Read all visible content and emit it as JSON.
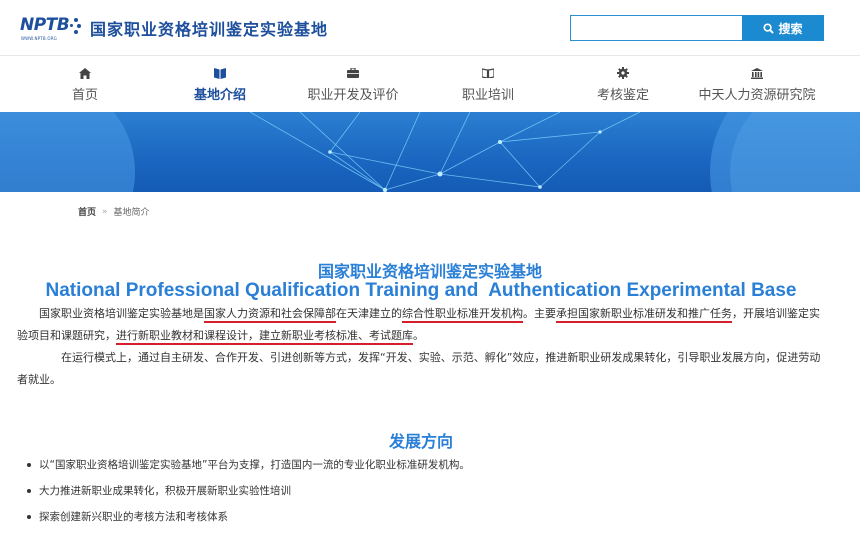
{
  "header": {
    "logo_text": "NPTB",
    "logo_sub": "WWW.NPTB.ORG",
    "site_title": "国家职业资格培训鉴定实验基地",
    "search": {
      "placeholder": "",
      "value": "",
      "button_label": "搜索",
      "button_icon": "search-icon"
    }
  },
  "nav": {
    "items": [
      {
        "label": "首页",
        "icon": "home-icon",
        "active": false
      },
      {
        "label": "基地介绍",
        "icon": "book-icon",
        "active": true
      },
      {
        "label": "职业开发及评价",
        "icon": "briefcase-icon",
        "active": false
      },
      {
        "label": "职业培训",
        "icon": "open-book-icon",
        "active": false
      },
      {
        "label": "考核鉴定",
        "icon": "gear-icon",
        "active": false
      },
      {
        "label": "中天人力资源研究院",
        "icon": "institution-icon",
        "active": false
      }
    ]
  },
  "breadcrumb": {
    "home": "首页",
    "separator": "»",
    "current": "基地简介"
  },
  "main": {
    "title_cn": "国家职业资格培训鉴定实验基地",
    "title_en": "National Professional Qualification Training and  Authentication Experimental Base",
    "p1": {
      "t1": "国家职业资格培训鉴定实验基地是",
      "u1": "国家人力资源和社会保障部",
      "t2": "在天津建立的",
      "u2": "综合性职业标准开发机构",
      "t3": "。主要",
      "u3": "承担国家新职业标准研发和推广任务",
      "t4": "，开展培训鉴定实验项目和课题研究，",
      "u4": "进行新职业教材和课程设计，建立新职业考核标准、考试题库",
      "t5": "。"
    },
    "p2": "在运行模式上，通过自主研发、合作开发、引进创新等方式，发挥“开发、实验、示范、孵化”效应，推进新职业研发成果转化，引导职业发展方向，促进劳动者就业。",
    "section_title": "发展方向",
    "bullets": [
      "以“国家职业资格培训鉴定实验基地”平台为支撑，打造国内一流的专业化职业标准研发机构。",
      "大力推进新职业成果转化，积极开展新职业实验性培训",
      "探索创建新兴职业的考核方法和考核体系"
    ]
  },
  "colors": {
    "brand": "#1d4f9c",
    "accent": "#2a7fd6",
    "search_button": "#1b8ad1",
    "banner": "#1a66c0",
    "underline": "#d4202a"
  }
}
